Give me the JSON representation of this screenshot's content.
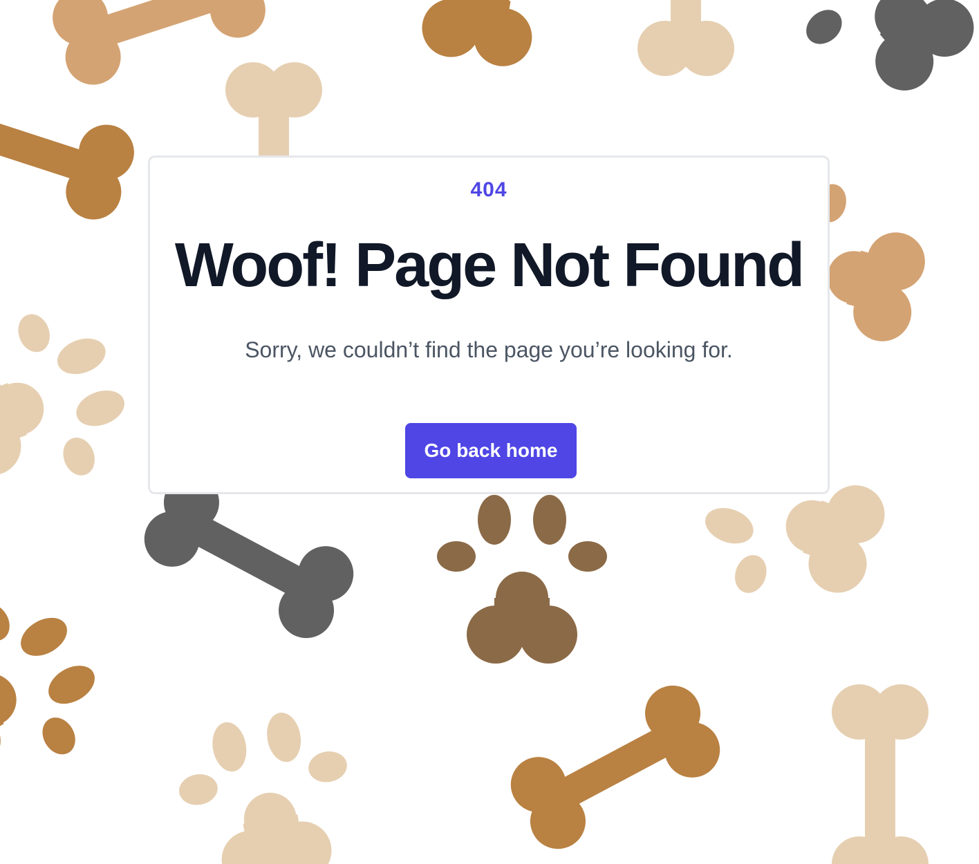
{
  "error": {
    "code": "404",
    "title": "Woof! Page Not Found",
    "message": "Sorry, we couldn’t find the page you’re looking for.",
    "home_button_label": "Go back home"
  },
  "theme": {
    "accent": "#4f46e5",
    "title_color": "#111827",
    "message_color": "#4b5563",
    "bone_colors": [
      "#d4a373",
      "#b98142",
      "#e6cfb1",
      "#616161",
      "#8b6a47"
    ]
  },
  "background": {
    "pattern": [
      "bone-icon",
      "paw-print-icon"
    ]
  }
}
